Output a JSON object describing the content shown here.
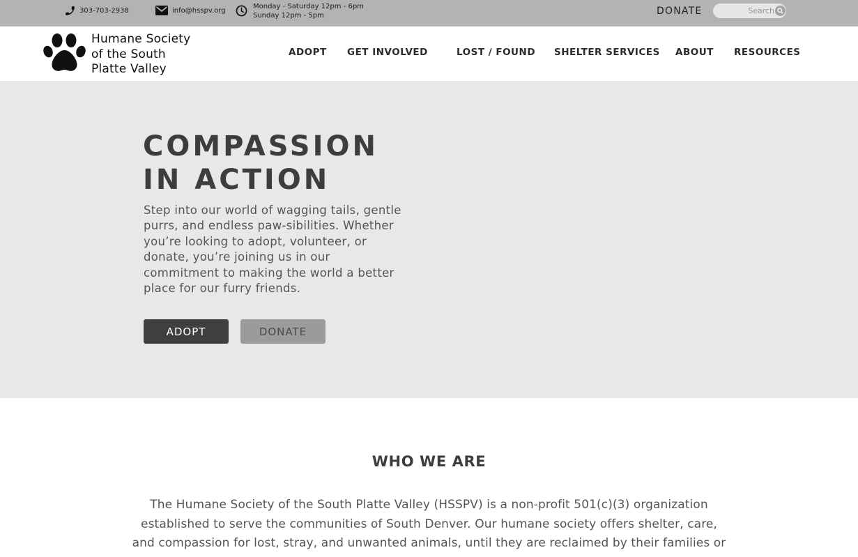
{
  "topbar": {
    "phone": "303-703-2938",
    "email": "info@hsspv.org",
    "hours_line1": "Monday - Saturday 12pm - 6pm",
    "hours_line2": "Sunday 12pm - 5pm",
    "donate_label": "DONATE",
    "search_placeholder": "Search",
    "icons": [
      "phone-icon",
      "envelope-icon",
      "clock-icon",
      "search-icon"
    ]
  },
  "logo": {
    "line1": "Humane Society",
    "line2": "of the South",
    "line3": "Platte Valley",
    "icon": "paw-icon"
  },
  "nav": {
    "adopt": "ADOPT",
    "get_involved": "GET INVOLVED",
    "lost_found": "LOST / FOUND",
    "shelter_services": "SHELTER SERVICES",
    "about": "ABOUT",
    "resources": "RESOURCES"
  },
  "hero": {
    "title_line1": "COMPASSION",
    "title_line2": "IN ACTION",
    "text": "Step into our world of wagging tails, gentle purrs, and endless paw-sibilities. Whether you’re looking to adopt, volunteer, or donate, you’re joining us in our commitment to making the world a better place for our furry friends.",
    "adopt_button": "ADOPT",
    "donate_button": "DONATE"
  },
  "who": {
    "title": "WHO WE ARE",
    "text": "The Humane Society of the South Platte Valley (HSSPV) is a non-profit 501(c)(3) organization established to serve the communities of South Denver.  Our humane society offers shelter, care, and compassion for lost, stray, and unwanted animals, until they are reclaimed by their families or"
  },
  "colors": {
    "topbar_bg": "#b3b3b3",
    "hero_bg": "#e8e8e8",
    "adopt_button_bg": "#3f3f3f",
    "donate_button_bg": "#9b9b9b"
  }
}
